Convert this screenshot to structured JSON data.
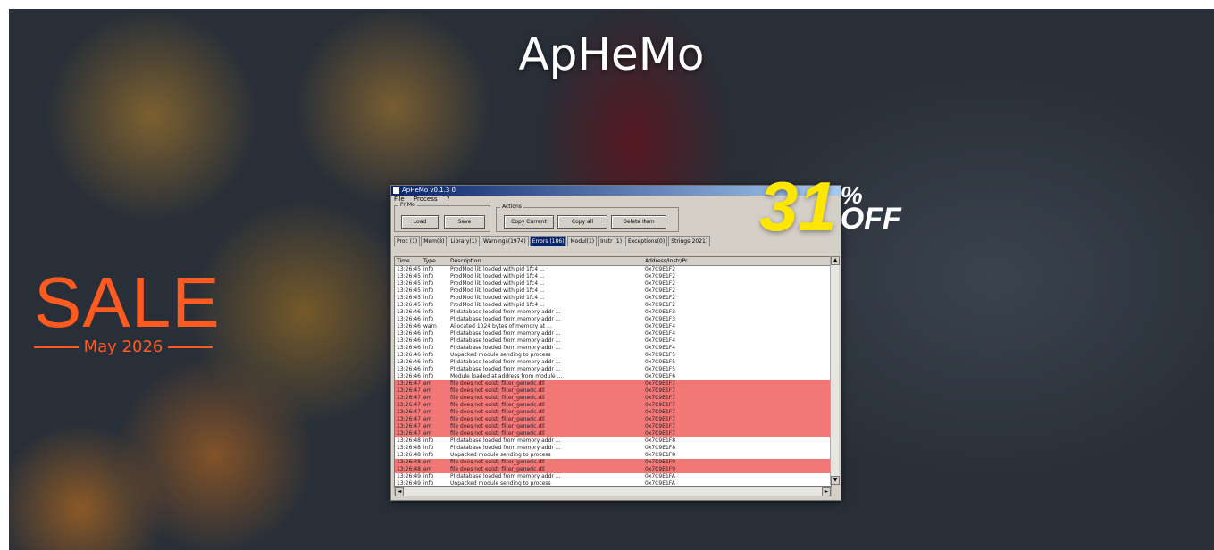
{
  "title": "ApHeMo",
  "sale": {
    "word": "SALE",
    "date": "May 2026"
  },
  "discount": {
    "number": "31",
    "percent": "%",
    "off": "OFF"
  },
  "app": {
    "window_title": "ApHeMo v0.1.3 0",
    "menu": [
      "File",
      "Process",
      "?"
    ],
    "group1_label": "Pr Mo",
    "group2_label": "Actions",
    "buttons": [
      "Load",
      "Save",
      "Copy Current",
      "Copy all",
      "Delete Item"
    ],
    "tabs": [
      "Proc (1)",
      "Mem(8)",
      "Library(1)",
      "Warnings(1974)",
      "Errors (186)",
      "Modul(1)",
      "Instr (1)",
      "Exceptions(0)",
      "Strings(2021)"
    ],
    "columns": [
      "Time",
      "Type",
      "Description",
      "Address/Instr/Pr"
    ],
    "rows": [
      {
        "t": "13:26:45",
        "y": "info",
        "d": "ProdMod lib loaded with pid 1fc4 ...",
        "a": "0x7C9E1F2",
        "red": false
      },
      {
        "t": "13:26:45",
        "y": "info",
        "d": "ProdMod lib loaded with pid 1fc4 ...",
        "a": "0x7C9E1F2",
        "red": false
      },
      {
        "t": "13:26:45",
        "y": "info",
        "d": "ProdMod lib loaded with pid 1fc4 ...",
        "a": "0x7C9E1F2",
        "red": false
      },
      {
        "t": "13:26:45",
        "y": "info",
        "d": "ProdMod lib loaded with pid 1fc4 ...",
        "a": "0x7C9E1F2",
        "red": false
      },
      {
        "t": "13:26:45",
        "y": "info",
        "d": "ProdMod lib loaded with pid 1fc4 ...",
        "a": "0x7C9E1F2",
        "red": false
      },
      {
        "t": "13:26:45",
        "y": "info",
        "d": "ProdMod lib loaded with pid 1fc4 ...",
        "a": "0x7C9E1F2",
        "red": false
      },
      {
        "t": "13:26:46",
        "y": "info",
        "d": "PI database loaded from memory addr ...",
        "a": "0x7C9E1F3",
        "red": false
      },
      {
        "t": "13:26:46",
        "y": "info",
        "d": "PI database loaded from memory addr ...",
        "a": "0x7C9E1F3",
        "red": false
      },
      {
        "t": "13:26:46",
        "y": "warn",
        "d": "Allocated 1024 bytes of memory at ...",
        "a": "0x7C9E1F4",
        "red": false
      },
      {
        "t": "13:26:46",
        "y": "info",
        "d": "PI database loaded from memory addr ...",
        "a": "0x7C9E1F4",
        "red": false
      },
      {
        "t": "13:26:46",
        "y": "info",
        "d": "PI database loaded from memory addr ...",
        "a": "0x7C9E1F4",
        "red": false
      },
      {
        "t": "13:26:46",
        "y": "info",
        "d": "PI database loaded from memory addr ...",
        "a": "0x7C9E1F4",
        "red": false
      },
      {
        "t": "13:26:46",
        "y": "info",
        "d": "Unpacked module sending to process",
        "a": "0x7C9E1F5",
        "red": false
      },
      {
        "t": "13:26:46",
        "y": "info",
        "d": "PI database loaded from memory addr ...",
        "a": "0x7C9E1F5",
        "red": false
      },
      {
        "t": "13:26:46",
        "y": "info",
        "d": "PI database loaded from memory addr ...",
        "a": "0x7C9E1F5",
        "red": false
      },
      {
        "t": "13:26:46",
        "y": "info",
        "d": "Module loaded at address from module ...",
        "a": "0x7C9E1F6",
        "red": false
      },
      {
        "t": "13:26:47",
        "y": "err",
        "d": "file does not exist: filter_generic.dll",
        "a": "0x7C9E1F7",
        "red": true
      },
      {
        "t": "13:26:47",
        "y": "err",
        "d": "file does not exist: filter_generic.dll",
        "a": "0x7C9E1F7",
        "red": true
      },
      {
        "t": "13:26:47",
        "y": "err",
        "d": "file does not exist: filter_generic.dll",
        "a": "0x7C9E1F7",
        "red": true
      },
      {
        "t": "13:26:47",
        "y": "err",
        "d": "file does not exist: filter_generic.dll",
        "a": "0x7C9E1F7",
        "red": true
      },
      {
        "t": "13:26:47",
        "y": "err",
        "d": "file does not exist: filter_generic.dll",
        "a": "0x7C9E1F7",
        "red": true
      },
      {
        "t": "13:26:47",
        "y": "err",
        "d": "file does not exist: filter_generic.dll",
        "a": "0x7C9E1F7",
        "red": true
      },
      {
        "t": "13:26:47",
        "y": "err",
        "d": "file does not exist: filter_generic.dll",
        "a": "0x7C9E1F7",
        "red": true
      },
      {
        "t": "13:26:47",
        "y": "err",
        "d": "file does not exist: filter_generic.dll",
        "a": "0x7C9E1F7",
        "red": true
      },
      {
        "t": "13:26:48",
        "y": "info",
        "d": "PI database loaded from memory addr ...",
        "a": "0x7C9E1F8",
        "red": false
      },
      {
        "t": "13:26:48",
        "y": "info",
        "d": "PI database loaded from memory addr ...",
        "a": "0x7C9E1F8",
        "red": false
      },
      {
        "t": "13:26:48",
        "y": "info",
        "d": "Unpacked module sending to process",
        "a": "0x7C9E1F8",
        "red": false
      },
      {
        "t": "13:26:48",
        "y": "err",
        "d": "file does not exist: filter_generic.dll",
        "a": "0x7C9E1F9",
        "red": true
      },
      {
        "t": "13:26:48",
        "y": "err",
        "d": "file does not exist: filter_generic.dll",
        "a": "0x7C9E1F9",
        "red": true
      },
      {
        "t": "13:26:49",
        "y": "info",
        "d": "PI database loaded from memory addr ...",
        "a": "0x7C9E1FA",
        "red": false
      },
      {
        "t": "13:26:49",
        "y": "info",
        "d": "Unpacked module sending to process",
        "a": "0x7C9E1FA",
        "red": false
      }
    ]
  },
  "colors": {
    "sale": "#ff5a1f",
    "discount": "#ffe600",
    "error_row": "#f47777"
  }
}
